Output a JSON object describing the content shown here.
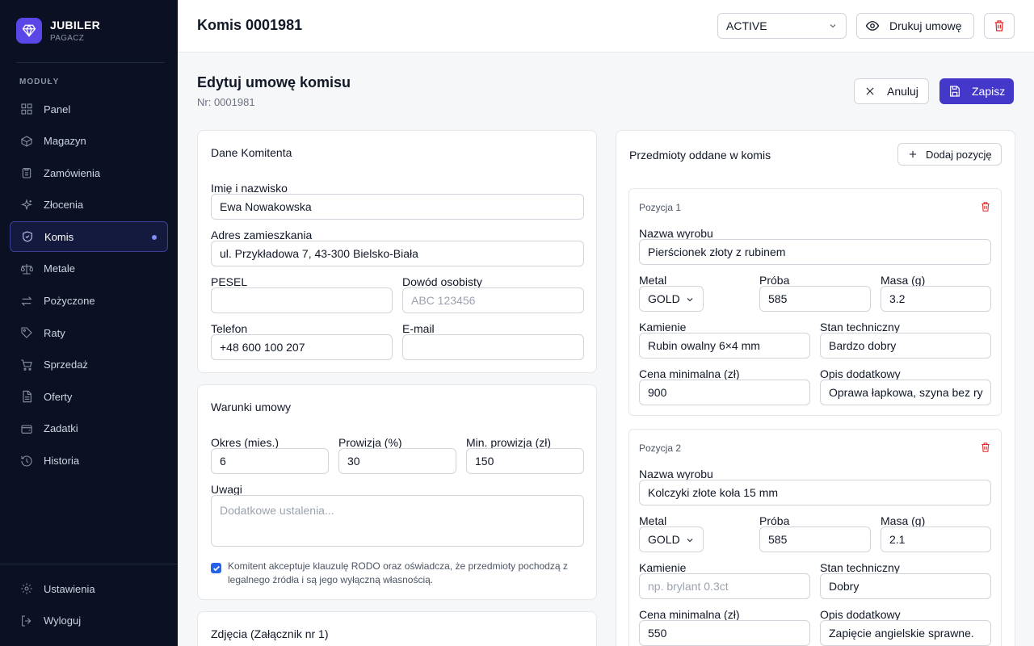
{
  "brand": {
    "name": "JUBILER",
    "sub": "PAGACZ"
  },
  "sidebar": {
    "section_label": "MODUŁY",
    "items": [
      {
        "label": "Panel",
        "icon": "grid-icon"
      },
      {
        "label": "Magazyn",
        "icon": "box-icon"
      },
      {
        "label": "Zamówienia",
        "icon": "clipboard-icon"
      },
      {
        "label": "Złocenia",
        "icon": "sparkles-icon"
      },
      {
        "label": "Komis",
        "icon": "shield-icon",
        "active": true
      },
      {
        "label": "Metale",
        "icon": "scale-icon"
      },
      {
        "label": "Pożyczone",
        "icon": "arrows-icon"
      },
      {
        "label": "Raty",
        "icon": "tag-icon"
      },
      {
        "label": "Sprzedaż",
        "icon": "cart-icon"
      },
      {
        "label": "Oferty",
        "icon": "document-icon"
      },
      {
        "label": "Zadatki",
        "icon": "wallet-icon"
      },
      {
        "label": "Historia",
        "icon": "history-icon"
      }
    ],
    "bottom": [
      {
        "label": "Ustawienia",
        "icon": "gear-icon"
      },
      {
        "label": "Wyloguj",
        "icon": "logout-icon"
      }
    ]
  },
  "header": {
    "title": "Komis 0001981",
    "status": "ACTIVE",
    "print_label": "Drukuj umowę"
  },
  "page": {
    "title": "Edytuj umowę komisu",
    "subtitle": "Nr: 0001981",
    "cancel_label": "Anuluj",
    "save_label": "Zapisz"
  },
  "client": {
    "title": "Dane Komitenta",
    "name_label": "Imię i nazwisko",
    "name_value": "Ewa Nowakowska",
    "address_label": "Adres zamieszkania",
    "address_value": "ul. Przykładowa 7, 43-300 Bielsko-Biała",
    "pesel_label": "PESEL",
    "pesel_value": "",
    "id_label": "Dowód osobisty",
    "id_placeholder": "ABC 123456",
    "phone_label": "Telefon",
    "phone_value": "+48 600 100 207",
    "email_label": "E-mail",
    "email_value": ""
  },
  "terms": {
    "title": "Warunki umowy",
    "period_label": "Okres (mies.)",
    "period_value": "6",
    "commission_label": "Prowizja (%)",
    "commission_value": "30",
    "min_commission_label": "Min. prowizja (zł)",
    "min_commission_value": "150",
    "notes_label": "Uwagi",
    "notes_placeholder": "Dodatkowe ustalenia...",
    "consent_line1": "Komitent akceptuje klauzulę RODO oraz oświadcza, że przedmioty pochodzą z",
    "consent_line2": "legalnego źródła i są jego wyłączną własnością.",
    "consent_checked": true
  },
  "photos": {
    "title": "Zdjęcia (Załącznik nr 1)"
  },
  "items_panel": {
    "title": "Przedmioty oddane w komis",
    "add_label": "Dodaj pozycję",
    "labels": {
      "name": "Nazwa wyrobu",
      "metal": "Metal",
      "assay": "Próba",
      "mass": "Masa (g)",
      "stones": "Kamienie",
      "condition": "Stan techniczny",
      "min_price": "Cena minimalna (zł)",
      "extra": "Opis dodatkowy"
    },
    "items": [
      {
        "pos": "Pozycja 1",
        "name": "Pierścionek złoty z rubinem",
        "metal": "GOLD",
        "assay": "585",
        "mass": "3.2",
        "stones": "Rubin owalny 6×4 mm",
        "stones_placeholder": "",
        "condition": "Bardzo dobry",
        "min_price": "900",
        "extra": "Oprawa łapkowa, szyna bez ry"
      },
      {
        "pos": "Pozycja 2",
        "name": "Kolczyki złote koła 15 mm",
        "metal": "GOLD",
        "assay": "585",
        "mass": "2.1",
        "stones": "",
        "stones_placeholder": "np. brylant 0.3ct",
        "condition": "Dobry",
        "min_price": "550",
        "extra": "Zapięcie angielskie sprawne."
      }
    ]
  }
}
